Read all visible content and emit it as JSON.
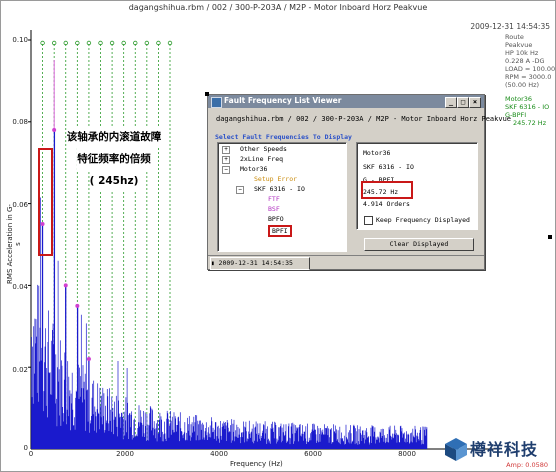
{
  "plot": {
    "title": "dagangshihua.rbm / 002 / 300-P-203A / M2P - Motor Inboard Horz Peakvue",
    "timestamp": "2009-12-31 14:54:35",
    "side_info": [
      "Route",
      "Peakvue",
      "HP 10k Hz",
      "0.228 A -DG",
      "LOAD = 100.00",
      "RPM = 3000.0",
      "(50.00 Hz)"
    ],
    "side_fault": [
      "Motor36",
      "SKF 6316 - IO",
      "G-BPFI",
      "245.72 Hz"
    ],
    "y_label": "RMS Acceleration in G-s",
    "y_ticks": [
      "0.10",
      "0.08",
      "0.06",
      "0.04",
      "0.02",
      "0"
    ],
    "x_ticks": [
      "0",
      "2000",
      "4000",
      "6000",
      "8000"
    ],
    "x_label": "Frequency (Hz)",
    "amp_readout": "Amp: 0.0580"
  },
  "chart_data": {
    "type": "line",
    "xlabel": "Frequency (Hz)",
    "ylabel": "RMS Acceleration in G-s",
    "xlim": [
      0,
      8400
    ],
    "ylim": [
      0,
      0.1
    ],
    "fault_lines_hz": [
      245.72,
      491.44,
      737.16,
      982.88,
      1228.6,
      1474.32,
      1720.04,
      1965.76,
      2211.48,
      2457.2,
      2702.92,
      2948.64
    ],
    "peaks": [
      {
        "x": 245,
        "y": 0.055
      },
      {
        "x": 491,
        "y": 0.078
      },
      {
        "x": 737,
        "y": 0.04
      },
      {
        "x": 983,
        "y": 0.035
      },
      {
        "x": 1229,
        "y": 0.022
      }
    ]
  },
  "annotation": {
    "line1": "该轴承的内滚道故障",
    "line2": "特征频率的倍频",
    "line3": "( 245hz)"
  },
  "dialog": {
    "title": "Fault Frequency List Viewer",
    "header": "dagangshihua.rbm / 002 / 300-P-203A / M2P - Motor Inboard Horz Peakvue",
    "select_label": "Select Fault Frequencies To Display",
    "tree": [
      {
        "label": "Other Speeds",
        "color": "#000000"
      },
      {
        "label": "2xLine Freq",
        "color": "#000000"
      },
      {
        "label": "Motor36",
        "color": "#000000"
      },
      {
        "label": "Setup Error",
        "color": "#c98a0a"
      },
      {
        "label": "SKF 6316 - IO",
        "color": "#000000"
      },
      {
        "label": "FTF",
        "color": "#b030c0"
      },
      {
        "label": "BSF",
        "color": "#b030c0"
      },
      {
        "label": "BPFO",
        "color": "#000000"
      },
      {
        "label": "BPFI",
        "color": "#000000"
      }
    ],
    "info_lines": [
      "Motor36",
      "SKF 6316 - IO",
      "G - BPFI",
      "245.72 Hz",
      "4.914 Orders"
    ],
    "keep_label": "Keep Frequency Displayed",
    "clear_label": "Clear Displayed",
    "status_tab": "2009-12-31  14:54:35"
  },
  "logo": {
    "text": "樽祥科技"
  }
}
